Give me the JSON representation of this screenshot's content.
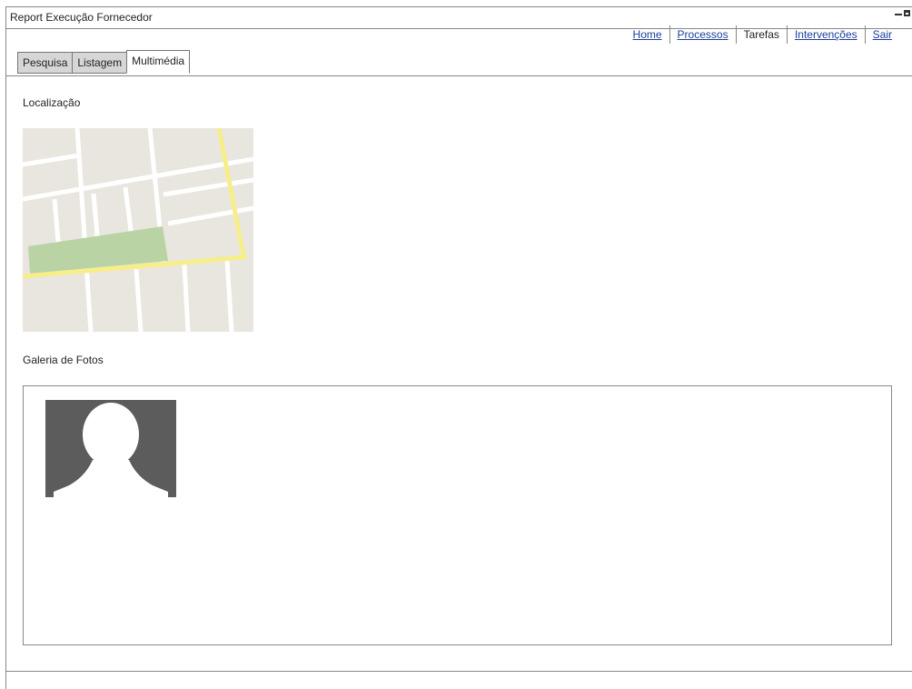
{
  "window": {
    "title": "Report Execução Fornecedor"
  },
  "nav": {
    "items": [
      {
        "label": "Home",
        "current": false
      },
      {
        "label": "Processos",
        "current": false
      },
      {
        "label": "Tarefas",
        "current": true
      },
      {
        "label": "Intervenções",
        "current": false
      },
      {
        "label": "Sair",
        "current": false
      }
    ]
  },
  "tabs": [
    {
      "label": "Pesquisa",
      "active": false
    },
    {
      "label": "Listagem",
      "active": false
    },
    {
      "label": "Multimédia",
      "active": true
    }
  ],
  "location": {
    "label": "Localização",
    "map_icon": "street-map-image"
  },
  "gallery": {
    "label": "Galeria de Fotos",
    "photo_icon": "person-silhouette-placeholder"
  },
  "colors": {
    "link": "#1a3f9a",
    "map_road": "#f7ee8a",
    "map_park": "#b9d3a4",
    "map_block": "#e8e6df",
    "photo_bg": "#5c5c5c"
  }
}
